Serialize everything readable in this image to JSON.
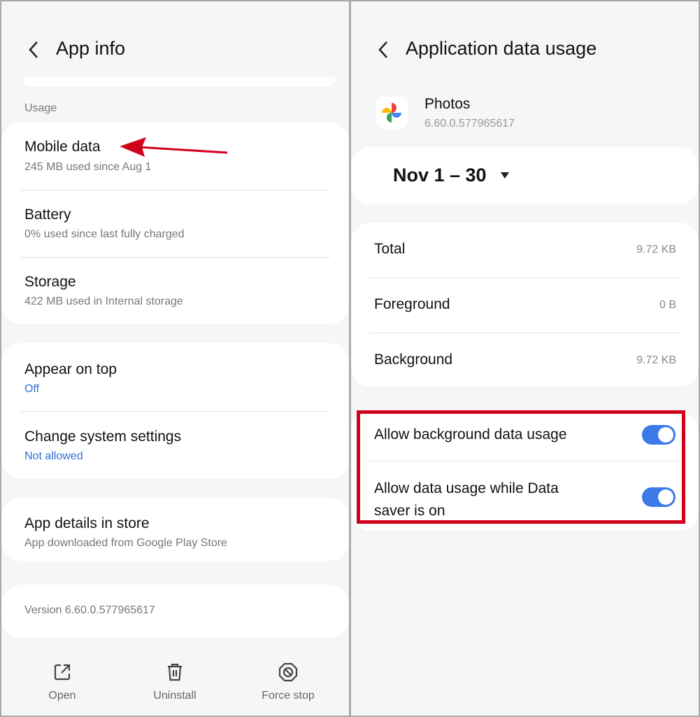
{
  "left": {
    "title": "App info",
    "section": "Usage",
    "usage_items": [
      {
        "label": "Mobile data",
        "sub": "245 MB used since Aug 1"
      },
      {
        "label": "Battery",
        "sub": "0% used since last fully charged"
      },
      {
        "label": "Storage",
        "sub": "422 MB used in Internal storage"
      }
    ],
    "perm_items": [
      {
        "label": "Appear on top",
        "sub": "Off"
      },
      {
        "label": "Change system settings",
        "sub": "Not allowed"
      }
    ],
    "store": {
      "label": "App details in store",
      "sub": "App downloaded from Google Play Store"
    },
    "version": "Version 6.60.0.577965617",
    "bottom": [
      {
        "label": "Open",
        "icon": "open-external-icon"
      },
      {
        "label": "Uninstall",
        "icon": "trash-icon"
      },
      {
        "label": "Force stop",
        "icon": "stop-icon"
      }
    ],
    "arrow_color": "#d0021b"
  },
  "right": {
    "title": "Application data usage",
    "app_name": "Photos",
    "app_version": "6.60.0.577965617",
    "date_range": "Nov 1 – 30",
    "usage": [
      {
        "label": "Total",
        "value": "9.72 KB"
      },
      {
        "label": "Foreground",
        "value": "0 B"
      },
      {
        "label": "Background",
        "value": "9.72 KB"
      }
    ],
    "toggles": [
      {
        "label": "Allow background data usage",
        "on": true
      },
      {
        "label": "Allow data usage while Data saver is on",
        "on": true
      }
    ],
    "highlight_color": "#d0021b",
    "accent": "#3b7ae8"
  }
}
